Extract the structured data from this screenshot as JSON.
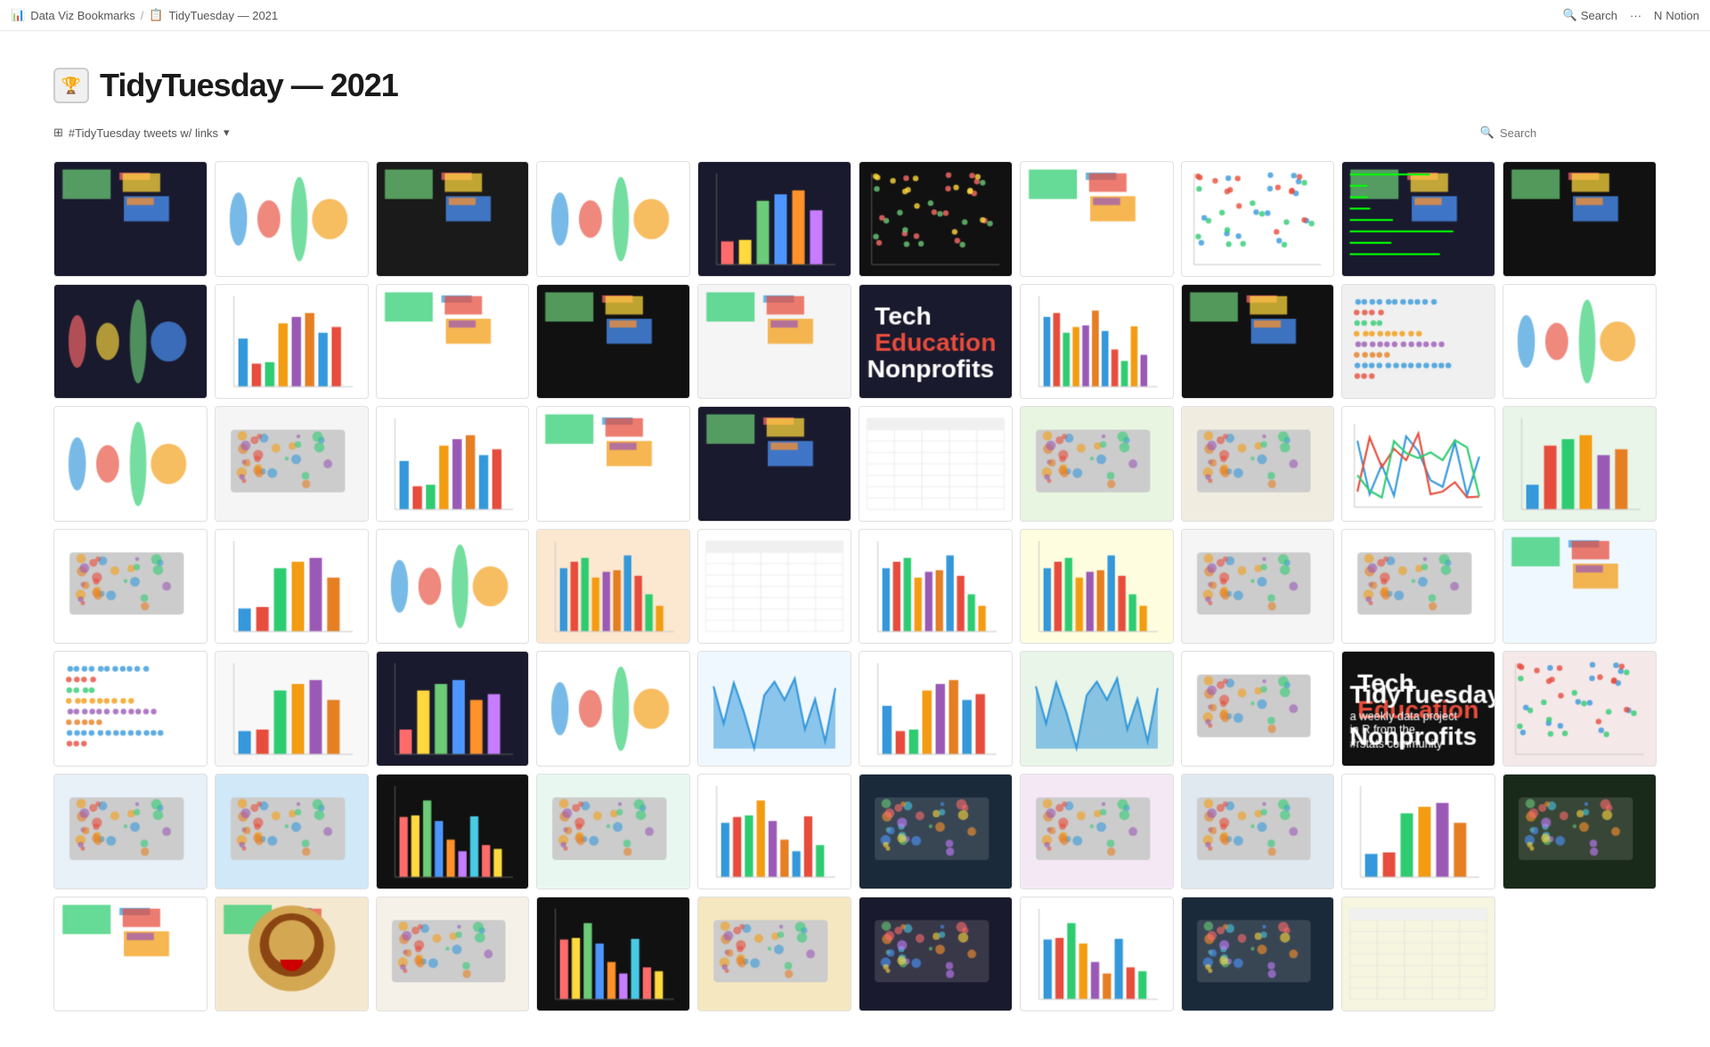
{
  "topbar": {
    "breadcrumb1": "Data Viz Bookmarks",
    "breadcrumb2": "TidyTuesday — 2021",
    "search_label": "Search",
    "more_label": "···",
    "notion_label": "Notion"
  },
  "page": {
    "title": "TidyTuesday — 2021",
    "filter_label": "#TidyTuesday tweets w/ links",
    "filter_chevron": "▾",
    "search_placeholder": "Search"
  },
  "gallery": {
    "items": [
      {
        "id": 1,
        "bg": "#1a1a2e",
        "type": "dark_multi"
      },
      {
        "id": 2,
        "bg": "#fff",
        "type": "violin_light"
      },
      {
        "id": 3,
        "bg": "#1a1a1a",
        "type": "dark_rainbow"
      },
      {
        "id": 4,
        "bg": "#fff",
        "type": "ridge_light"
      },
      {
        "id": 5,
        "bg": "#1a1a2e",
        "type": "dark_bar"
      },
      {
        "id": 6,
        "bg": "#111",
        "type": "dark_scatter"
      },
      {
        "id": 7,
        "bg": "#fff",
        "type": "small_multi"
      },
      {
        "id": 8,
        "bg": "#fff",
        "type": "scatter_light"
      },
      {
        "id": 9,
        "bg": "#1a1a2e",
        "type": "dark_terminal"
      },
      {
        "id": 10,
        "bg": "#111",
        "type": "dark_stripe"
      },
      {
        "id": 11,
        "bg": "#1a1a2e",
        "type": "dark_ridge2"
      },
      {
        "id": 12,
        "bg": "#fff",
        "type": "bar_map"
      },
      {
        "id": 13,
        "bg": "#fff",
        "type": "richest"
      },
      {
        "id": 14,
        "bg": "#111",
        "type": "dark_radar"
      },
      {
        "id": 15,
        "bg": "#f5f5f5",
        "type": "gender_gap"
      },
      {
        "id": 16,
        "bg": "#1a1a2e",
        "type": "tech_edu"
      },
      {
        "id": 17,
        "bg": "#fff",
        "type": "salary_bars"
      },
      {
        "id": 18,
        "bg": "#111",
        "type": "dark_fish"
      },
      {
        "id": 19,
        "bg": "#f0f0f0",
        "type": "table_dots"
      },
      {
        "id": 20,
        "bg": "#fff",
        "type": "violin2"
      },
      {
        "id": 21,
        "bg": "#fff",
        "type": "violin3"
      },
      {
        "id": 22,
        "bg": "#f5f5f5",
        "type": "heatmap"
      },
      {
        "id": 23,
        "bg": "#fff",
        "type": "pie_bar"
      },
      {
        "id": 24,
        "bg": "#fff",
        "type": "box_plot"
      },
      {
        "id": 25,
        "bg": "#1a1a2e",
        "type": "dark_rect"
      },
      {
        "id": 26,
        "bg": "#fff",
        "type": "table_light"
      },
      {
        "id": 27,
        "bg": "#e8f5e0",
        "type": "usa_green"
      },
      {
        "id": 28,
        "bg": "#f0ece0",
        "type": "usa_beige"
      },
      {
        "id": 29,
        "bg": "#fff",
        "type": "line_salaries"
      },
      {
        "id": 30,
        "bg": "#e8f5e8",
        "type": "bar_green"
      },
      {
        "id": 31,
        "bg": "#fff",
        "type": "usa_pink"
      },
      {
        "id": 32,
        "bg": "#fff",
        "type": "bar_tall"
      },
      {
        "id": 33,
        "bg": "#fff",
        "type": "ridge_salary"
      },
      {
        "id": 34,
        "bg": "#fce8d0",
        "type": "bar_orange"
      },
      {
        "id": 35,
        "bg": "#fff",
        "type": "table_small"
      },
      {
        "id": 36,
        "bg": "#fff",
        "type": "bar_chart2"
      },
      {
        "id": 37,
        "bg": "#fffde0",
        "type": "bar_yellow"
      },
      {
        "id": 38,
        "bg": "#f5f5f5",
        "type": "dot_map"
      },
      {
        "id": 39,
        "bg": "#fff",
        "type": "usa_teal"
      },
      {
        "id": 40,
        "bg": "#f0f8ff",
        "type": "fuzzy"
      },
      {
        "id": 41,
        "bg": "#fff",
        "type": "dot_plot2"
      },
      {
        "id": 42,
        "bg": "#f8f8f8",
        "type": "bar_bump"
      },
      {
        "id": 43,
        "bg": "#1a1a2e",
        "type": "dark_bar2"
      },
      {
        "id": 44,
        "bg": "#fff",
        "type": "ridge3"
      },
      {
        "id": 45,
        "bg": "#f0f8ff",
        "type": "area_blue"
      },
      {
        "id": 46,
        "bg": "#fff",
        "type": "bar_pop"
      },
      {
        "id": 47,
        "bg": "#e8f5e8",
        "type": "area_green"
      },
      {
        "id": 48,
        "bg": "#fff",
        "type": "usa_map2"
      },
      {
        "id": 49,
        "bg": "#111",
        "type": "tidytuesday_logo"
      },
      {
        "id": 50,
        "bg": "#f5e8e8",
        "type": "scatter_pink"
      },
      {
        "id": 51,
        "bg": "#e8f0f8",
        "type": "alaska"
      },
      {
        "id": 52,
        "bg": "#d0e8f8",
        "type": "usa_purple"
      },
      {
        "id": 53,
        "bg": "#111",
        "type": "broadband_dark"
      },
      {
        "id": 54,
        "bg": "#e8f8f0",
        "type": "california"
      },
      {
        "id": 55,
        "bg": "#fff",
        "type": "bar_broadband"
      },
      {
        "id": 56,
        "bg": "#1a2a3a",
        "type": "usa_dark"
      },
      {
        "id": 57,
        "bg": "#f5e8f5",
        "type": "usa_spotted"
      },
      {
        "id": 58,
        "bg": "#e0e8f0",
        "type": "usa_choropleth"
      },
      {
        "id": 59,
        "bg": "#fff",
        "type": "line_bar"
      },
      {
        "id": 60,
        "bg": "#1a2a1a",
        "type": "usa_green2"
      },
      {
        "id": 61,
        "bg": "#fff",
        "type": "disparities"
      },
      {
        "id": 62,
        "bg": "#f5e8d0",
        "type": "lion"
      },
      {
        "id": 63,
        "bg": "#f5f0e8",
        "type": "usa_red"
      },
      {
        "id": 64,
        "bg": "#111",
        "type": "broadband_grid"
      },
      {
        "id": 65,
        "bg": "#f5e8c0",
        "type": "usa_yellow"
      },
      {
        "id": 66,
        "bg": "#1a1a2e",
        "type": "usa_dark2"
      },
      {
        "id": 67,
        "bg": "#fff",
        "type": "bar_broadband2"
      },
      {
        "id": 68,
        "bg": "#1a2a3a",
        "type": "usa_teal2"
      },
      {
        "id": 69,
        "bg": "#f5f5e0",
        "type": "table_broad"
      }
    ]
  }
}
